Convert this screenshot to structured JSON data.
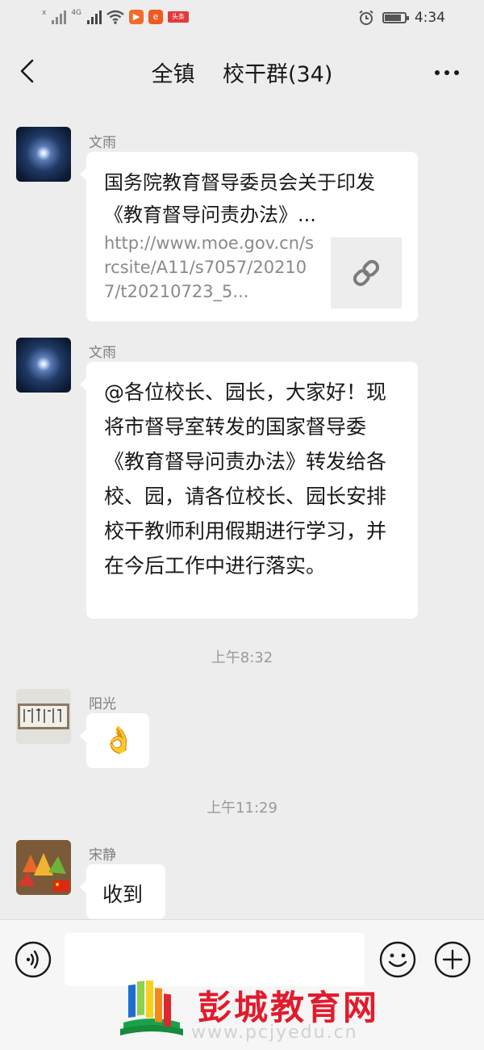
{
  "status_bar": {
    "signal_1_label": "x",
    "signal_2_label": "4G",
    "app_badge": "头条",
    "time": "4:34"
  },
  "header": {
    "title": "全镇    校干群(34)"
  },
  "messages": [
    {
      "sender": "文雨",
      "type": "link",
      "title": "国务院教育督导委员会关于印发《教育督导问责办法》...",
      "url": "http://www.moe.gov.cn/srcsite/A11/s7057/202107/t20210723_5..."
    },
    {
      "sender": "文雨",
      "type": "text",
      "text": "@各位校长、园长，大家好！现将市督导室转发的国家督导委《教育督导问责办法》转发给各校、园，请各位校长、园长安排校干教师利用假期进行学习，并在今后工作中进行落实。"
    },
    {
      "sender": "阳光",
      "type": "emoji",
      "text": "👌"
    },
    {
      "sender": "宋静",
      "type": "text",
      "text": "收到"
    }
  ],
  "timestamps": [
    "上午8:32",
    "上午11:29"
  ],
  "watermark": {
    "name": "彭城教育网",
    "url": "www.pcjyedu.cn"
  },
  "colors": {
    "background": "#ededed",
    "bubble": "#ffffff",
    "watermark_red": "#e21b2c"
  }
}
